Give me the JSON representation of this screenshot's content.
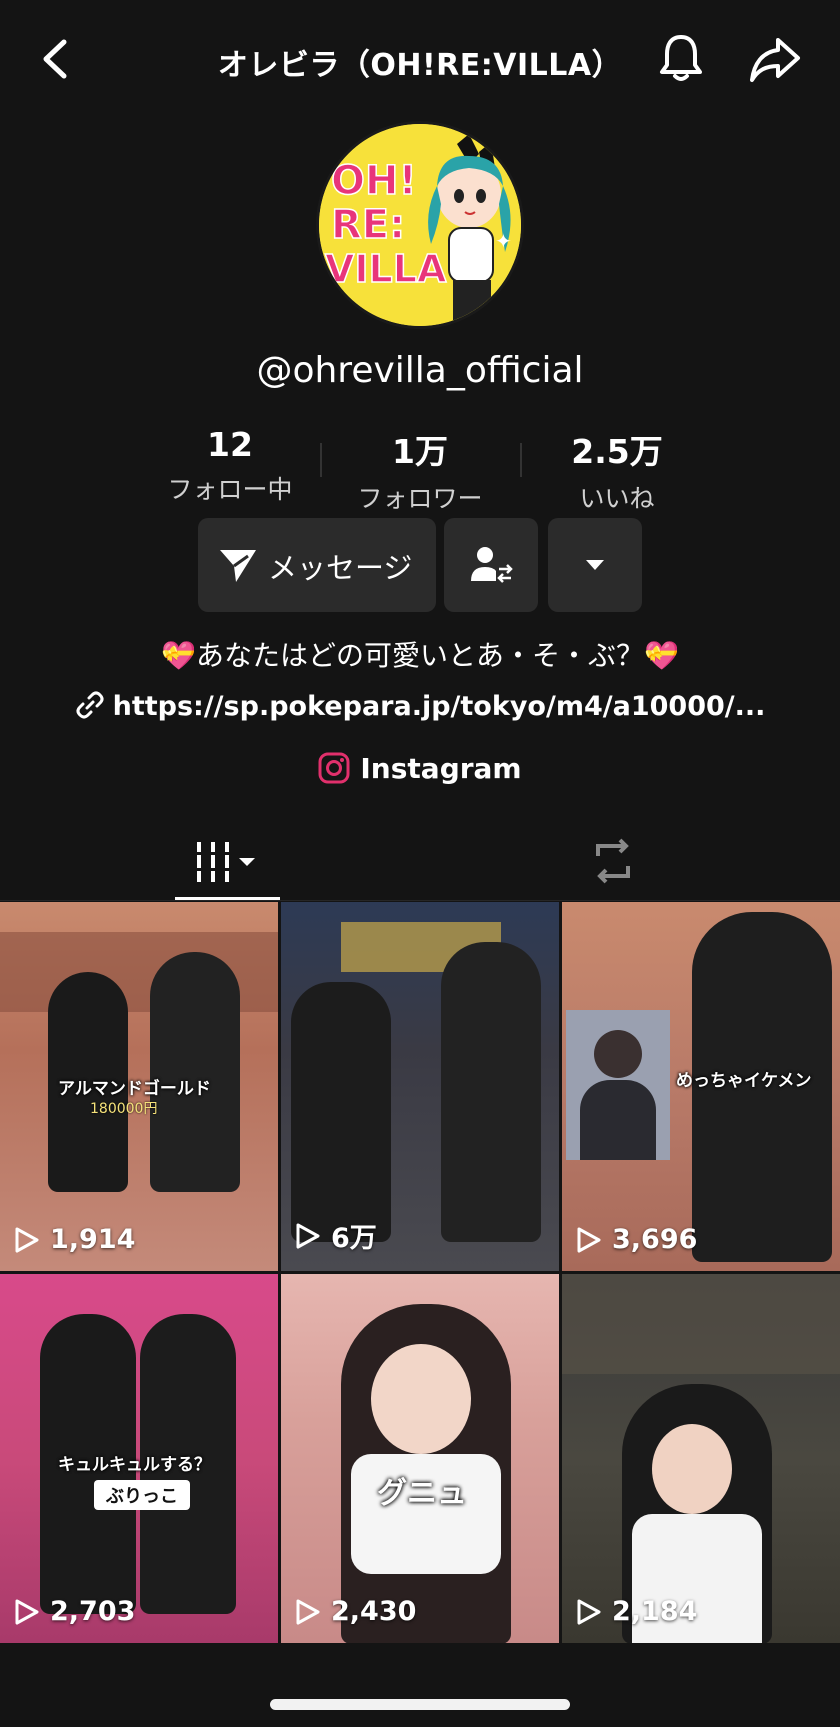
{
  "header": {
    "title": "オレビラ（OH!RE:VILLA）"
  },
  "avatar": {
    "logo_text": "OH! RE: VILLA"
  },
  "profile": {
    "handle": "@ohrevilla_official",
    "stats": [
      {
        "value": "12",
        "label": "フォロー中"
      },
      {
        "value": "1万",
        "label": "フォロワー"
      },
      {
        "value": "2.5万",
        "label": "いいね"
      }
    ],
    "message_button": "メッセージ",
    "bio": "💝あなたはどの可愛いとあ・そ・ぶ？💝",
    "link": "https://sp.pokepara.jp/tokyo/m4/a10000/...",
    "instagram": "Instagram"
  },
  "videos": [
    {
      "views": "1,914",
      "caption": "アルマンドゴールド",
      "subcaption": "180000円"
    },
    {
      "views": "6万"
    },
    {
      "views": "3,696",
      "caption": "めっちゃイケメン"
    },
    {
      "views": "2,703",
      "caption": "キュルキュルする？",
      "pill": "ぶりっこ"
    },
    {
      "views": "2,430",
      "caption": "グニュ"
    },
    {
      "views": "2,184"
    }
  ],
  "colors": {
    "background": "#141414",
    "button": "#2b2b2b",
    "avatar_bg": "#f7e13a",
    "instagram": "#e1306c"
  }
}
